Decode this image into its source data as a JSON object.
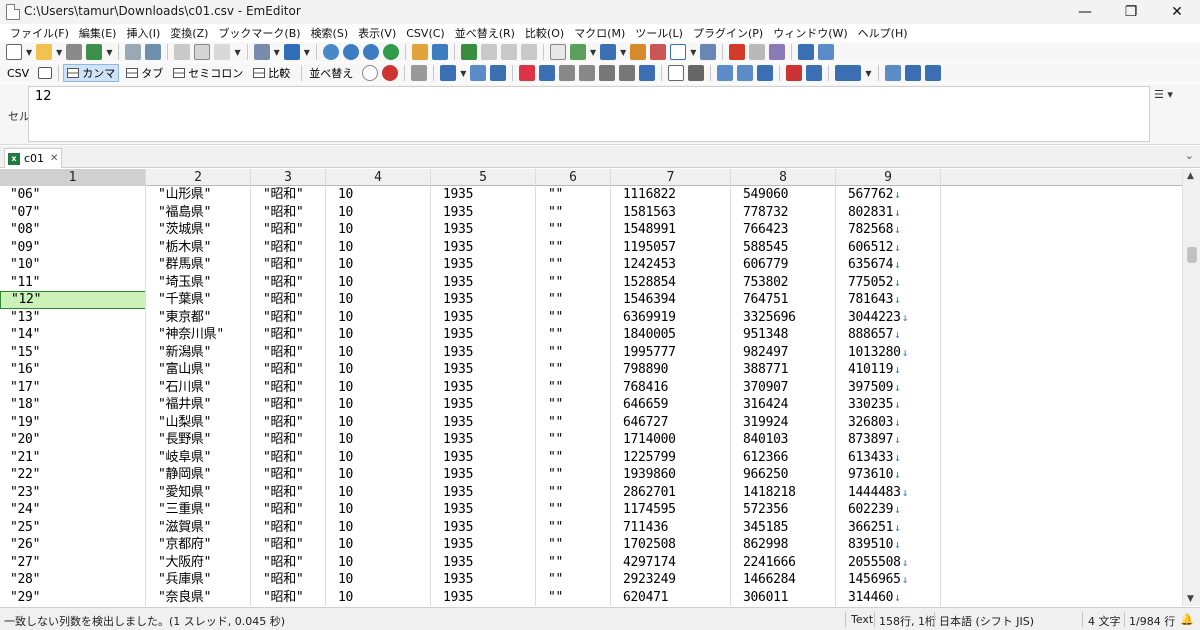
{
  "window": {
    "title": "C:\\Users\\tamur\\Downloads\\c01.csv - EmEditor",
    "minimize": "—",
    "maximize": "❐",
    "close": "✕"
  },
  "menu": [
    "ファイル(F)",
    "編集(E)",
    "挿入(I)",
    "変換(Z)",
    "ブックマーク(B)",
    "検索(S)",
    "表示(V)",
    "CSV(C)",
    "並べ替え(R)",
    "比較(O)",
    "マクロ(M)",
    "ツール(L)",
    "プラグイン(P)",
    "ウィンドウ(W)",
    "ヘルプ(H)"
  ],
  "csv_toolbar": {
    "csv": "CSV",
    "comma": "カンマ",
    "tab": "タブ",
    "semicolon": "セミコロン",
    "compare": "比較",
    "sort": "並べ替え"
  },
  "cell_edit": {
    "label": "セル",
    "value": "12"
  },
  "doc_tab": {
    "name": "c01",
    "close": "✕"
  },
  "columns": [
    "1",
    "2",
    "3",
    "4",
    "5",
    "6",
    "7",
    "8",
    "9"
  ],
  "selected_column": "1",
  "selected_row_index": 6,
  "rows": [
    [
      "\"06\"",
      "\"山形県\"",
      "\"昭和\"",
      "10",
      "1935",
      "\"\"",
      "1116822",
      "549060",
      "567762"
    ],
    [
      "\"07\"",
      "\"福島県\"",
      "\"昭和\"",
      "10",
      "1935",
      "\"\"",
      "1581563",
      "778732",
      "802831"
    ],
    [
      "\"08\"",
      "\"茨城県\"",
      "\"昭和\"",
      "10",
      "1935",
      "\"\"",
      "1548991",
      "766423",
      "782568"
    ],
    [
      "\"09\"",
      "\"栃木県\"",
      "\"昭和\"",
      "10",
      "1935",
      "\"\"",
      "1195057",
      "588545",
      "606512"
    ],
    [
      "\"10\"",
      "\"群馬県\"",
      "\"昭和\"",
      "10",
      "1935",
      "\"\"",
      "1242453",
      "606779",
      "635674"
    ],
    [
      "\"11\"",
      "\"埼玉県\"",
      "\"昭和\"",
      "10",
      "1935",
      "\"\"",
      "1528854",
      "753802",
      "775052"
    ],
    [
      "\"12\"",
      "\"千葉県\"",
      "\"昭和\"",
      "10",
      "1935",
      "\"\"",
      "1546394",
      "764751",
      "781643"
    ],
    [
      "\"13\"",
      "\"東京都\"",
      "\"昭和\"",
      "10",
      "1935",
      "\"\"",
      "6369919",
      "3325696",
      "3044223"
    ],
    [
      "\"14\"",
      "\"神奈川県\"",
      "\"昭和\"",
      "10",
      "1935",
      "\"\"",
      "1840005",
      "951348",
      "888657"
    ],
    [
      "\"15\"",
      "\"新潟県\"",
      "\"昭和\"",
      "10",
      "1935",
      "\"\"",
      "1995777",
      "982497",
      "1013280"
    ],
    [
      "\"16\"",
      "\"富山県\"",
      "\"昭和\"",
      "10",
      "1935",
      "\"\"",
      "798890",
      "388771",
      "410119"
    ],
    [
      "\"17\"",
      "\"石川県\"",
      "\"昭和\"",
      "10",
      "1935",
      "\"\"",
      "768416",
      "370907",
      "397509"
    ],
    [
      "\"18\"",
      "\"福井県\"",
      "\"昭和\"",
      "10",
      "1935",
      "\"\"",
      "646659",
      "316424",
      "330235"
    ],
    [
      "\"19\"",
      "\"山梨県\"",
      "\"昭和\"",
      "10",
      "1935",
      "\"\"",
      "646727",
      "319924",
      "326803"
    ],
    [
      "\"20\"",
      "\"長野県\"",
      "\"昭和\"",
      "10",
      "1935",
      "\"\"",
      "1714000",
      "840103",
      "873897"
    ],
    [
      "\"21\"",
      "\"岐阜県\"",
      "\"昭和\"",
      "10",
      "1935",
      "\"\"",
      "1225799",
      "612366",
      "613433"
    ],
    [
      "\"22\"",
      "\"静岡県\"",
      "\"昭和\"",
      "10",
      "1935",
      "\"\"",
      "1939860",
      "966250",
      "973610"
    ],
    [
      "\"23\"",
      "\"愛知県\"",
      "\"昭和\"",
      "10",
      "1935",
      "\"\"",
      "2862701",
      "1418218",
      "1444483"
    ],
    [
      "\"24\"",
      "\"三重県\"",
      "\"昭和\"",
      "10",
      "1935",
      "\"\"",
      "1174595",
      "572356",
      "602239"
    ],
    [
      "\"25\"",
      "\"滋賀県\"",
      "\"昭和\"",
      "10",
      "1935",
      "\"\"",
      "711436",
      "345185",
      "366251"
    ],
    [
      "\"26\"",
      "\"京都府\"",
      "\"昭和\"",
      "10",
      "1935",
      "\"\"",
      "1702508",
      "862998",
      "839510"
    ],
    [
      "\"27\"",
      "\"大阪府\"",
      "\"昭和\"",
      "10",
      "1935",
      "\"\"",
      "4297174",
      "2241666",
      "2055508"
    ],
    [
      "\"28\"",
      "\"兵庫県\"",
      "\"昭和\"",
      "10",
      "1935",
      "\"\"",
      "2923249",
      "1466284",
      "1456965"
    ],
    [
      "\"29\"",
      "\"奈良県\"",
      "\"昭和\"",
      "10",
      "1935",
      "\"\"",
      "620471",
      "306011",
      "314460"
    ]
  ],
  "eol_marker": "↓",
  "status": {
    "message": "一致しない列数を検出しました。(1 スレッド, 0.045 秒)",
    "mode": "Text",
    "position": "158行, 1桁",
    "encoding": "日本語 (シフト JIS)",
    "chars": "4 文字",
    "lines": "1/984 行",
    "bell": "🔔"
  },
  "icons": [
    "new-file-icon",
    "open-icon",
    "save-icon",
    "print-icon",
    "cut-icon",
    "copy-icon",
    "paste-icon",
    "undo-icon",
    "redo-icon",
    "find-icon",
    "filter-icon",
    "sort-ascending-icon",
    "sort-descending-icon",
    "bookmark-icon",
    "settings-icon"
  ]
}
